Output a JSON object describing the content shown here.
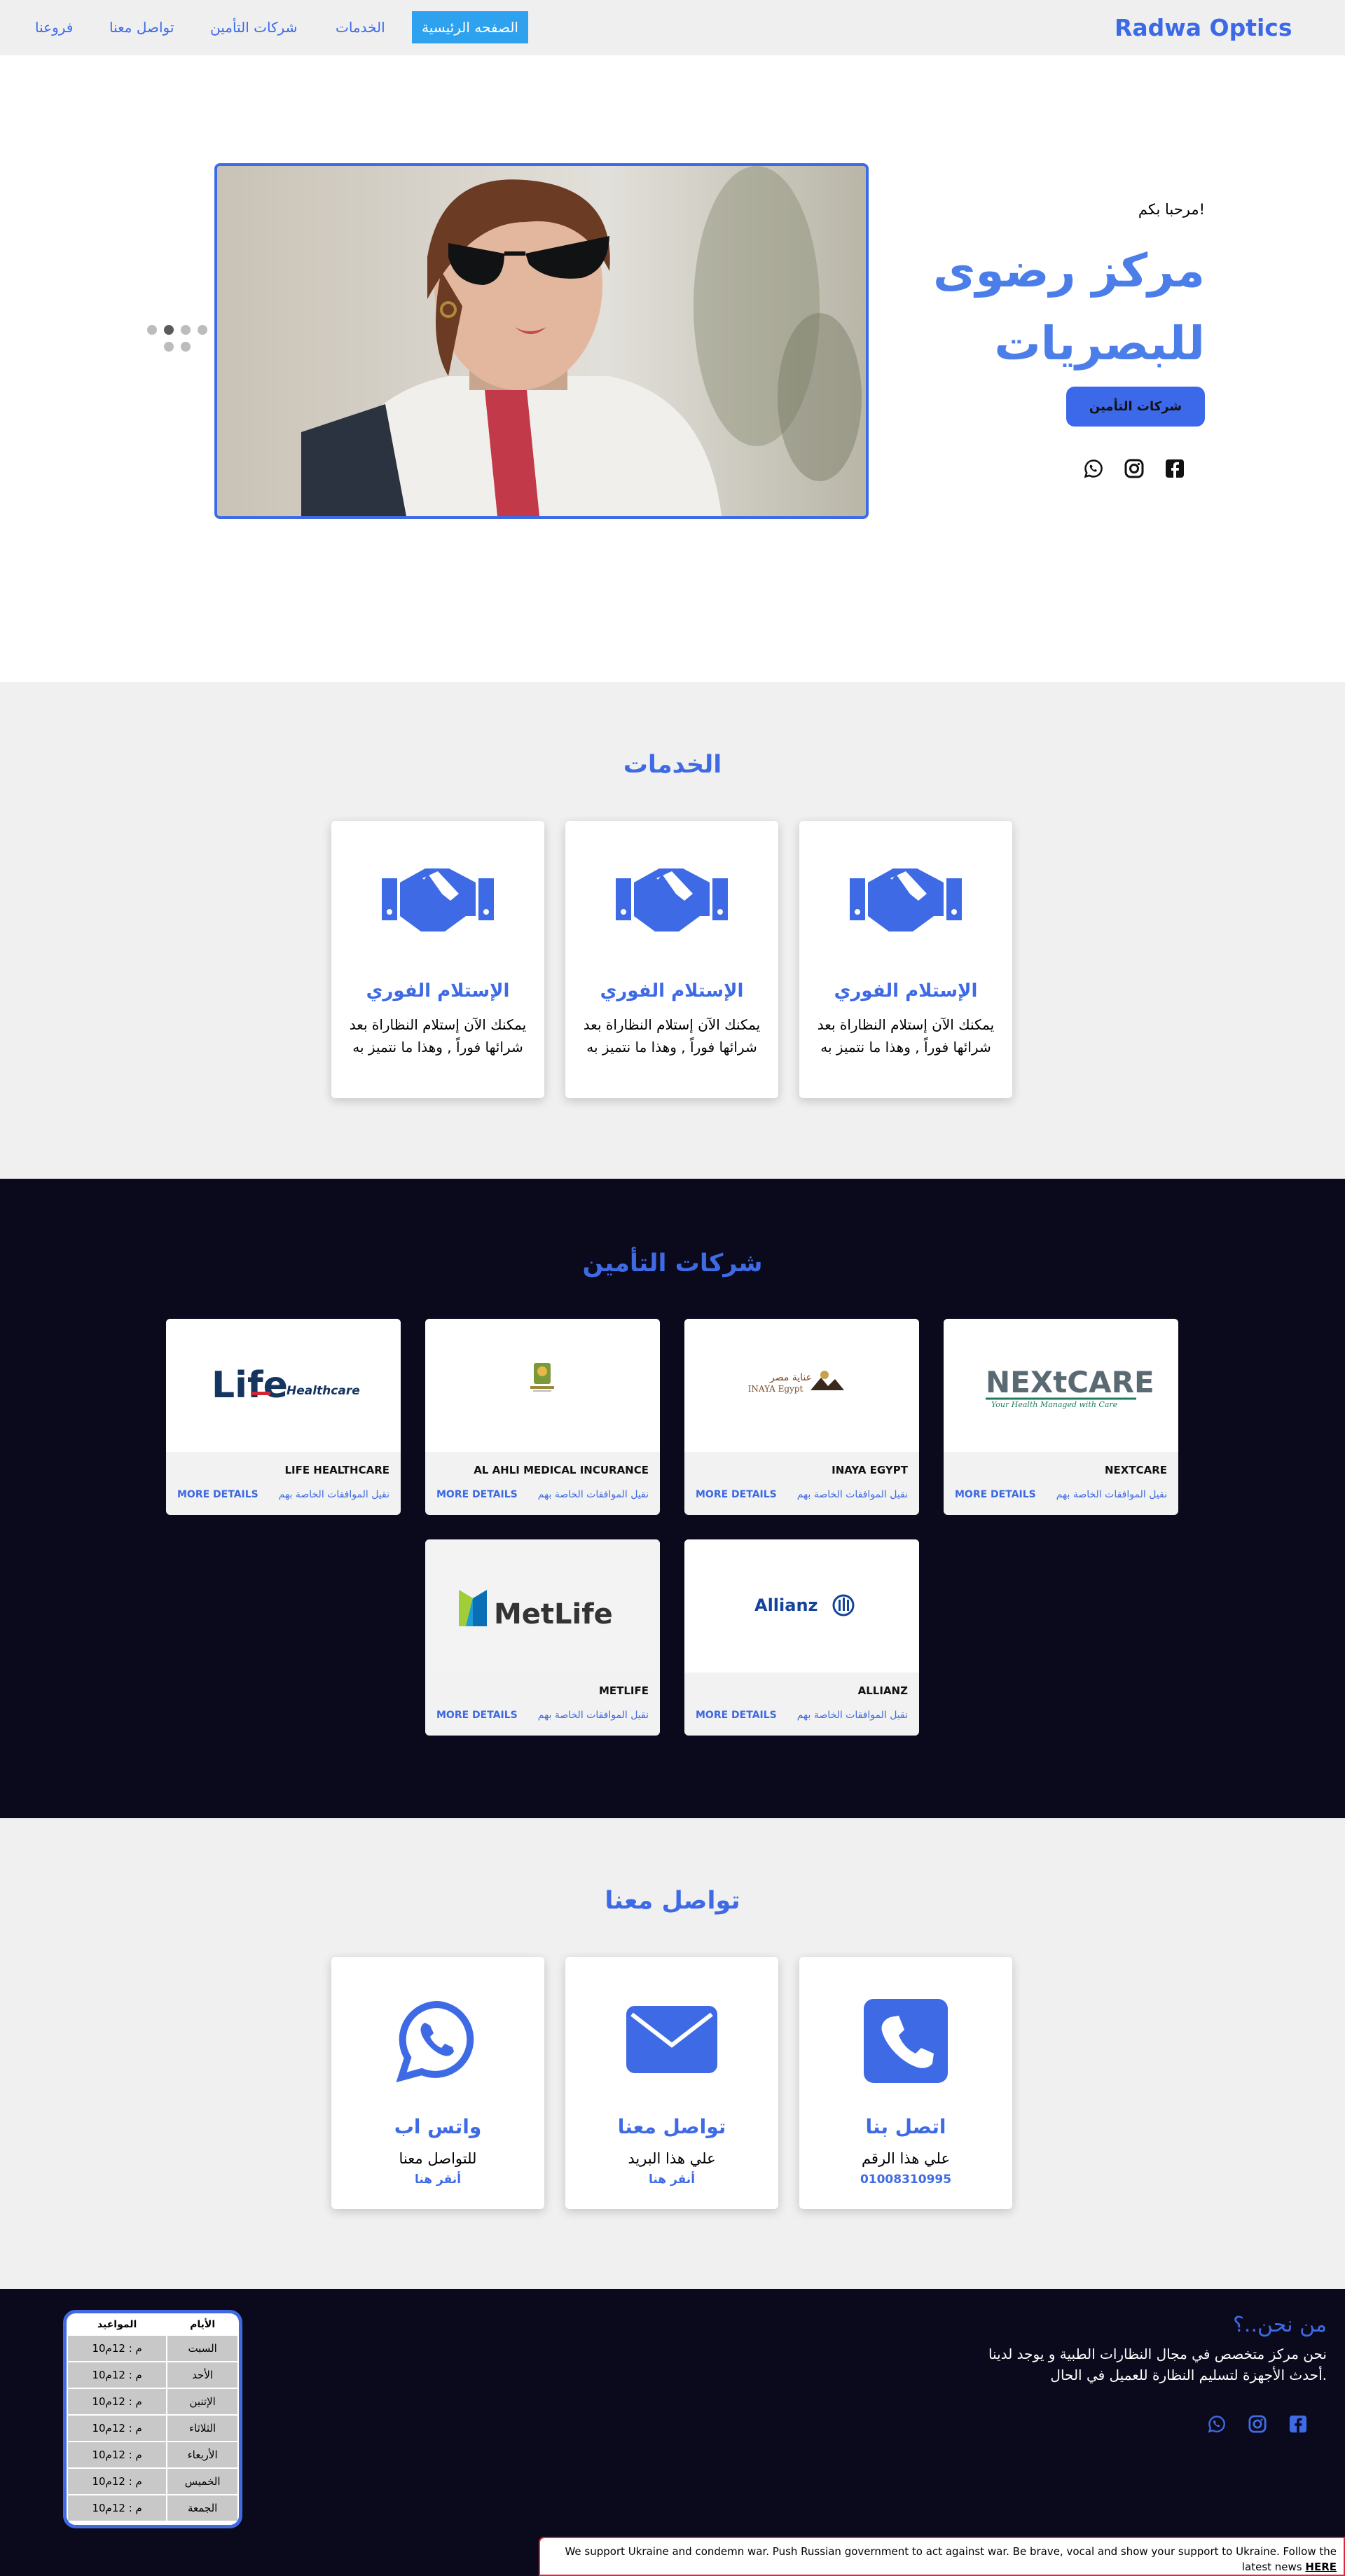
{
  "nav": {
    "brand": "Radwa Optics",
    "links": [
      "الصفحه الرئيسية",
      "الخدمات",
      "شركات التأمين",
      "تواصل معنا",
      "فروعنا"
    ]
  },
  "hero": {
    "welcome": "مرحبا بكم!",
    "title": "مركز رضوى للبصريات",
    "button": "شركات التأمين"
  },
  "services": {
    "title": "الخدمات",
    "cards": [
      {
        "title": "الإستلام الفوري",
        "text": "يمكنك الآن إستلام النظاراة بعد شرائها فوراً , وهذا ما نتميز به"
      },
      {
        "title": "الإستلام الفوري",
        "text": "يمكنك الآن إستلام النظاراة بعد شرائها فوراً , وهذا ما نتميز به"
      },
      {
        "title": "الإستلام الفوري",
        "text": "يمكنك الآن إستلام النظاراة بعد شرائها فوراً , وهذا ما نتميز به"
      }
    ]
  },
  "insurance": {
    "title": "شركات التأمين",
    "more": "MORE DETAILS",
    "upload": "نقيل الموافقات الخاصة بهم",
    "companies": [
      {
        "name": "NEXTCARE",
        "logo_text": "NEXtCARE",
        "tagline": "Your Health Managed with Care"
      },
      {
        "name": "INAYA EGYPT",
        "logo_text": "INAYA Egypt",
        "tagline": "عناية مصر"
      },
      {
        "name": "AL AHLI MEDICAL INCURANCE",
        "logo_text": "",
        "tagline": ""
      },
      {
        "name": "LIFE HEALTHCARE",
        "logo_text": "Life",
        "tagline": "Healthcare"
      },
      {
        "name": "ALLIANZ",
        "logo_text": "Allianz",
        "tagline": ""
      },
      {
        "name": "METLIFE",
        "logo_text": "MetLife",
        "tagline": ""
      }
    ]
  },
  "contact": {
    "title": "تواصل معنا",
    "cards": [
      {
        "title": "اتصل بنا",
        "text": "علي هذا الرقم",
        "link": "01008310995"
      },
      {
        "title": "تواصل معنا",
        "text": "علي هذا البريد",
        "link": "أنقر هنا"
      },
      {
        "title": "واتس اب",
        "text": "للتواصل معنا",
        "link": "أنقر هنا"
      }
    ]
  },
  "footer": {
    "about_title": "من نحن..؟",
    "about_text": "نحن مركز متخصص في مجال النظارات الطبية و يوجد لدينا أحدث الأجهزة لتسليم النظارة للعميل في الحال.",
    "hours_headers": [
      "الأيام",
      "المواعيد"
    ],
    "hours": [
      [
        "السبت",
        "10م : 12م"
      ],
      [
        "الأحد",
        "10م : 12م"
      ],
      [
        "الإتنين",
        "10م : 12م"
      ],
      [
        "الثلاثاء",
        "10م : 12م"
      ],
      [
        "الأربعاء",
        "10م : 12م"
      ],
      [
        "الخميس",
        "10م : 12م"
      ],
      [
        "الجمعة",
        "10م : 12م"
      ]
    ]
  },
  "banner": {
    "text": "We support Ukraine and condemn war. Push Russian government to act against war. Be brave, vocal and show your support to Ukraine. Follow the latest news",
    "link": "HERE"
  },
  "colors": {
    "accent": "#3c6ae6",
    "dark": "#0b0a1d",
    "light": "#f0f0f0",
    "active": "#2ea2ee"
  }
}
